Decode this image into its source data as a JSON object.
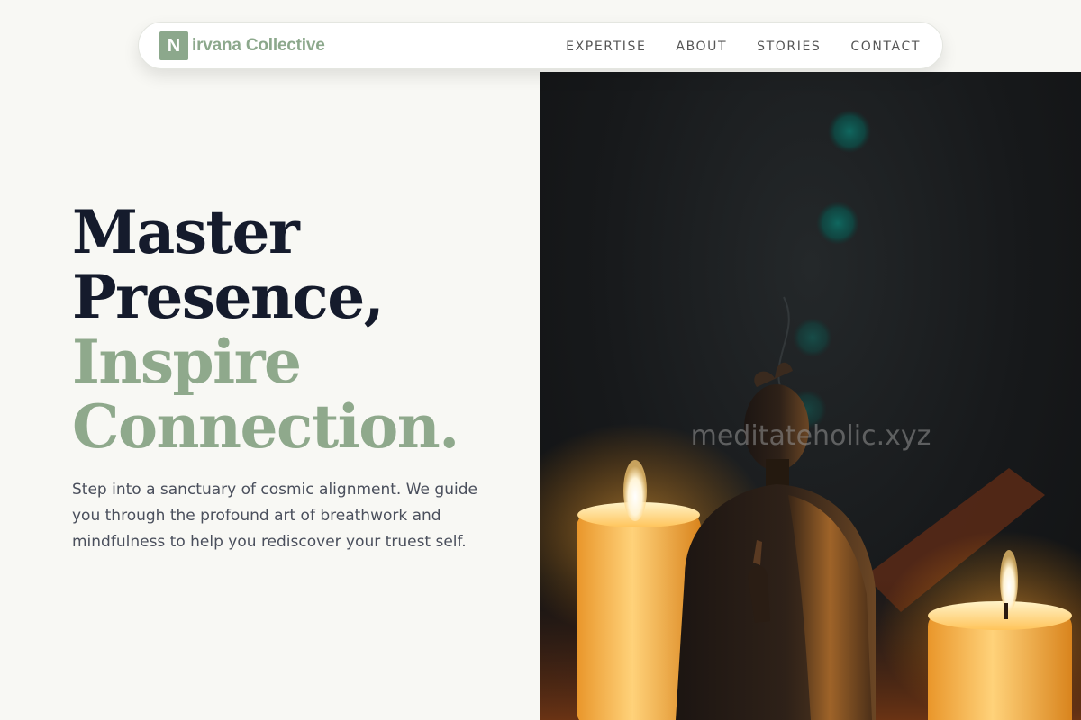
{
  "brand": {
    "logo_letter": "N",
    "name_rest": "irvana Collective",
    "accent_color": "#8ca88c"
  },
  "nav": {
    "links": [
      "EXPERTISE",
      "ABOUT",
      "STORIES",
      "CONTACT"
    ]
  },
  "hero": {
    "headline_line1": "Master",
    "headline_line2": "Presence,",
    "headline_line3": "Inspire",
    "headline_line4": "Connection.",
    "subtitle": "Step into a sanctuary of cosmic alignment. We guide you through the profound art of breathwork and mindfulness to help you rediscover your truest self."
  },
  "image": {
    "watermark": "meditateholic.xyz",
    "description_icon": "buddha-candles-photo"
  },
  "colors": {
    "background": "#f8f8f4",
    "headline_dark": "#151b2c",
    "headline_green": "#8fa98c",
    "body_text": "#4a4f5c"
  }
}
